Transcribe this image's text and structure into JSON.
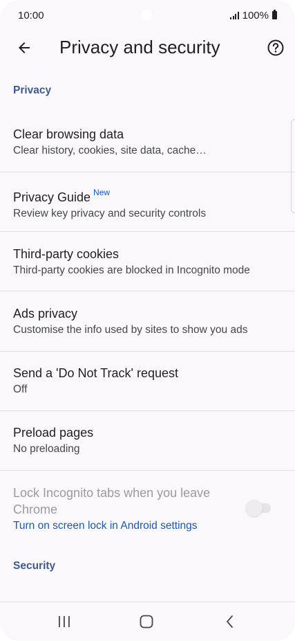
{
  "status_bar": {
    "time": "10:00",
    "battery": "100%"
  },
  "app_bar": {
    "title": "Privacy and security",
    "back_icon": "arrow-left-icon",
    "help_icon": "help-circle-icon"
  },
  "privacy_section": {
    "header": "Privacy",
    "items": [
      {
        "title": "Clear browsing data",
        "subtitle": "Clear history, cookies, site data, cache…"
      },
      {
        "title": "Privacy Guide",
        "badge": "New",
        "subtitle": "Review key privacy and security controls"
      },
      {
        "title": "Third-party cookies",
        "subtitle": "Third-party cookies are blocked in Incognito mode"
      },
      {
        "title": "Ads privacy",
        "subtitle": "Customise the info used by sites to show you ads"
      },
      {
        "title": "Send a 'Do Not Track' request",
        "subtitle": "Off"
      },
      {
        "title": "Preload pages",
        "subtitle": "No preloading"
      }
    ],
    "lock_incognito": {
      "title_line1": "Lock Incognito tabs when you leave",
      "title_line2": "Chrome",
      "link": "Turn on screen lock in Android settings",
      "enabled": false,
      "toggle_on": false
    }
  },
  "security_section": {
    "header": "Security"
  },
  "colors": {
    "accent_header": "#3c5a92",
    "link": "#1b5aa8",
    "background": "#fbf8fc"
  }
}
